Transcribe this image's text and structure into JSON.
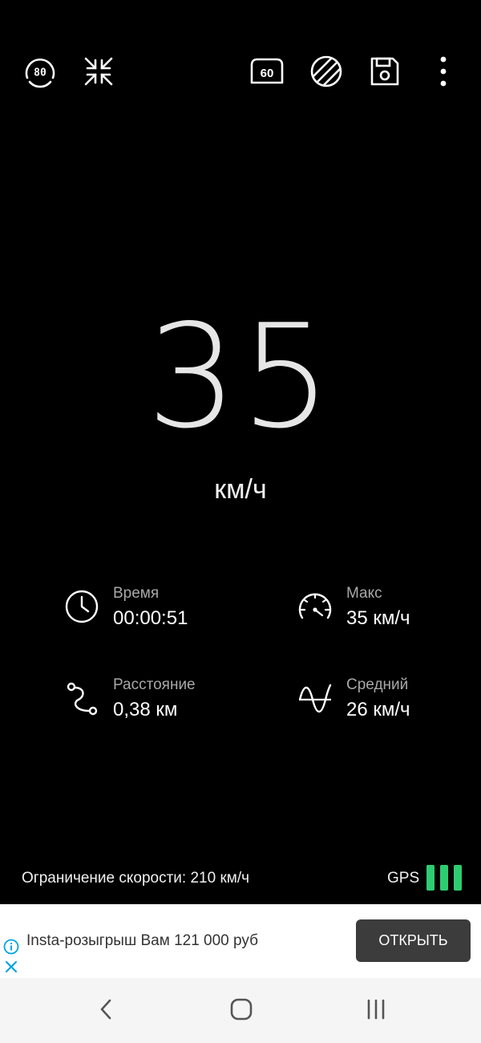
{
  "toolbar": {
    "left_buttons": [
      "hud-80-icon",
      "fullscreen-exit-icon"
    ],
    "hud_badge": "80",
    "speed_limit_badge": "60",
    "right_buttons": [
      "speed-limit-60-icon",
      "night-mode-icon",
      "save-icon",
      "more-vert-icon"
    ]
  },
  "speedometer": {
    "speed": "35",
    "unit": "км/ч"
  },
  "stats": {
    "time": {
      "label": "Время",
      "value": "00:00:51",
      "icon": "clock-icon"
    },
    "max": {
      "label": "Макс",
      "value": "35 км/ч",
      "icon": "speedometer-icon"
    },
    "distance": {
      "label": "Расстояние",
      "value": "0,38 км",
      "icon": "route-icon"
    },
    "average": {
      "label": "Средний",
      "value": "26 км/ч",
      "icon": "wave-icon"
    }
  },
  "footer": {
    "speed_limit_text": "Ограничение скорости: 210 км/ч",
    "gps_label": "GPS",
    "gps_bars_active": 3,
    "gps_color": "#2ecc71"
  },
  "ad": {
    "text": "Insta-розыгрыш Вам 121 000 руб",
    "button_label": "ОТКРЫТЬ",
    "info_color": "#00a4e4"
  },
  "navbar": {
    "buttons": [
      "back-icon",
      "home-icon",
      "recents-icon"
    ]
  }
}
